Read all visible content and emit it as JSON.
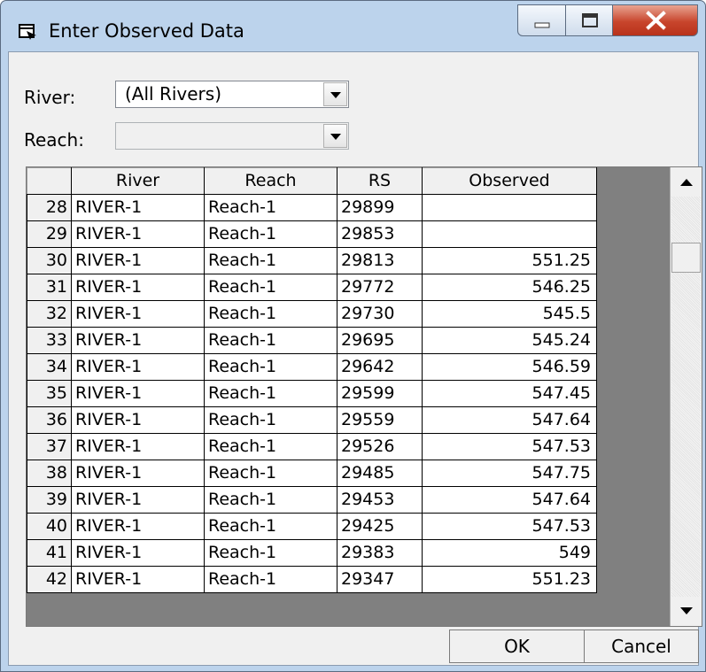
{
  "window": {
    "title": "Enter Observed Data"
  },
  "filters": {
    "river_label": "River:",
    "river_value": "(All Rivers)",
    "reach_label": "Reach:",
    "reach_value": ""
  },
  "table": {
    "columns": [
      "",
      "River",
      "Reach",
      "RS",
      "Observed"
    ],
    "rows": [
      [
        "28",
        "RIVER-1",
        "Reach-1",
        "29899",
        ""
      ],
      [
        "29",
        "RIVER-1",
        "Reach-1",
        "29853",
        ""
      ],
      [
        "30",
        "RIVER-1",
        "Reach-1",
        "29813",
        "551.25"
      ],
      [
        "31",
        "RIVER-1",
        "Reach-1",
        "29772",
        "546.25"
      ],
      [
        "32",
        "RIVER-1",
        "Reach-1",
        "29730",
        "545.5"
      ],
      [
        "33",
        "RIVER-1",
        "Reach-1",
        "29695",
        "545.24"
      ],
      [
        "34",
        "RIVER-1",
        "Reach-1",
        "29642",
        "546.59"
      ],
      [
        "35",
        "RIVER-1",
        "Reach-1",
        "29599",
        "547.45"
      ],
      [
        "36",
        "RIVER-1",
        "Reach-1",
        "29559",
        "547.64"
      ],
      [
        "37",
        "RIVER-1",
        "Reach-1",
        "29526",
        "547.53"
      ],
      [
        "38",
        "RIVER-1",
        "Reach-1",
        "29485",
        "547.75"
      ],
      [
        "39",
        "RIVER-1",
        "Reach-1",
        "29453",
        "547.64"
      ],
      [
        "40",
        "RIVER-1",
        "Reach-1",
        "29425",
        "547.53"
      ],
      [
        "41",
        "RIVER-1",
        "Reach-1",
        "29383",
        "549"
      ],
      [
        "42",
        "RIVER-1",
        "Reach-1",
        "29347",
        "551.23"
      ]
    ]
  },
  "buttons": {
    "ok": "OK",
    "cancel": "Cancel"
  },
  "icons": {
    "app": "window-icon",
    "minimize": "minimize-icon",
    "maximize": "maximize-icon",
    "close": "close-icon",
    "dropdown": "chevron-down-icon",
    "scroll_up": "scroll-up-arrow-icon",
    "scroll_down": "scroll-down-arrow-icon"
  },
  "colors": {
    "title_bar": "#bcd3ec",
    "close_button": "#c8452c",
    "grid_empty": "#808080"
  }
}
